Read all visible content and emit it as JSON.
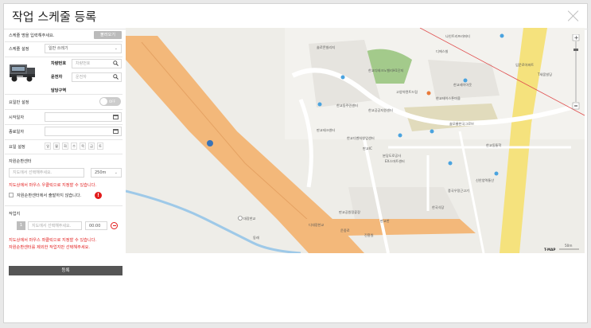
{
  "modal": {
    "title": "작업 스케줄 등록"
  },
  "panel": {
    "schedule_name_label": "스케줄 명을 입력해주세요.",
    "load_button": "불러오기",
    "schedule_setting_label": "스케줄 설정",
    "schedule_setting_value": "일반 쓰레기",
    "vehicle_number_label": "차량번호",
    "vehicle_number_placeholder": "차량번호",
    "driver_label": "운전자",
    "driver_placeholder": "운전자",
    "area_label": "담당구역",
    "day_setting_label": "요일만 설정",
    "toggle_text": "OFF",
    "start_date_label": "시작일자",
    "end_date_label": "종료일자",
    "weekday_label": "요일 설정",
    "weekdays": [
      "일",
      "월",
      "화",
      "수",
      "목",
      "금",
      "토"
    ],
    "resource_center_label": "자원순환센터",
    "resource_center_placeholder": "지도에서 선택해주세요.",
    "radius_value": "250m",
    "resource_hint": "지도상에서 마우스 우클릭으로 지정할 수 있습니다.",
    "no_depart_label": "자원순환센터에서 출발하지 않습니다.",
    "worksite_label": "작업지",
    "worksite_index": "1",
    "worksite_placeholder": "지도에서 선택해주세요.",
    "worksite_time": "00:00",
    "worksite_hint_1": "지도상에서 마우스 좌클릭으로 지정할 수 있습니다.",
    "worksite_hint_2": "자원순환센터를 제외한 작업지만 선택해주세요.",
    "register_button": "등록"
  },
  "map": {
    "labels": [
      "나인트리프라퍼티",
      "디에스빌",
      "입문로아파트",
      "솔로몬빌리지",
      "한교디테크노밸리H1단지",
      "T세움빌딩",
      "고양아텐트드림",
      "한교테이스톤마을",
      "한교레이아웃",
      "한교동주민센터",
      "한교공공지원센터",
      "솔모롱한국그로브",
      "판교IC",
      "한교디벤처창업센터",
      "판교테크센터",
      "분당도로공사",
      "EX스마트센터",
      "한교동통학",
      "신안양역통산",
      "한국식당",
      "풍국우정근고기",
      "대장한교",
      "동래",
      "디대장한교",
      "판교공원정류장",
      "판교한",
      "운중로",
      "진흥원"
    ],
    "scale_brand": "T-MAP",
    "scale_text": "50m"
  }
}
